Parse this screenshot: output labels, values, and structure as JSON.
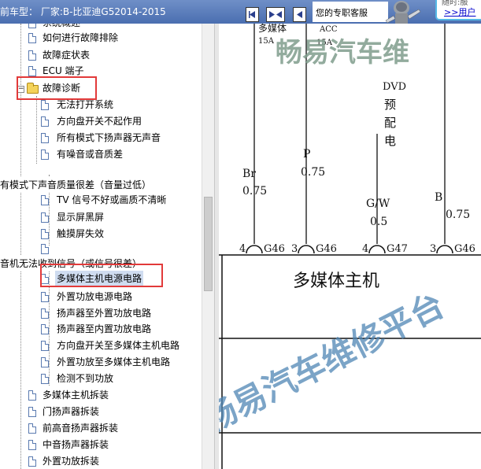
{
  "topbar": {
    "model_label": "前车型：  厂家:B-比亚迪G52014-2015",
    "nav_buttons": [
      "prev-arrow-icon",
      "double-arrow-icon",
      "next-arrow-icon"
    ],
    "support_text": "您的专职客服",
    "user_link_faint": "随时:服",
    "user_link": ">>用户"
  },
  "tree": {
    "items": [
      {
        "label": "系统概述"
      },
      {
        "label": "如何进行故障排除"
      },
      {
        "label": "故障症状表"
      },
      {
        "label": "ECU 端子"
      },
      {
        "label": "故障诊断",
        "folder": true,
        "expander": "⊟"
      },
      {
        "label": "无法打开系统"
      },
      {
        "label": "方向盘开关不起作用"
      },
      {
        "label": "所有模式下扬声器无声音"
      },
      {
        "label": "有噪音或音质差"
      },
      {
        "label": "有模式下声音质量很差（音量过低）"
      },
      {
        "label": "TV 信号不好或画质不清晰"
      },
      {
        "label": "显示屏黑屏"
      },
      {
        "label": "触摸屏失效"
      },
      {
        "label": ""
      },
      {
        "label": "音机无法收到信号（或信号很差）"
      },
      {
        "label": "多媒体主机电源电路",
        "selected": true
      },
      {
        "label": "外置功放电源电路"
      },
      {
        "label": "扬声器至外置功放电路"
      },
      {
        "label": "扬声器至内置功放电路"
      },
      {
        "label": "方向盘开关至多媒体主机电路"
      },
      {
        "label": "外置功放至多媒体主机电路"
      },
      {
        "label": "检测不到功放"
      },
      {
        "label": "多媒体主机拆装"
      },
      {
        "label": "门扬声器拆装"
      },
      {
        "label": "前高音扬声器拆装"
      },
      {
        "label": "中音扬声器拆装"
      },
      {
        "label": "外置功放拆装"
      }
    ]
  },
  "diagram": {
    "top_labels": [
      "多媒体",
      "15A",
      "ACC",
      "15A"
    ],
    "dvd_label": [
      "DVD",
      "预",
      "配",
      "电"
    ],
    "wires": [
      {
        "name": "Br",
        "size": "0.75",
        "pin": "4",
        "conn": "G46"
      },
      {
        "name": "P",
        "size": "0.75",
        "pin": "3",
        "conn": "G46"
      },
      {
        "name": "G/W",
        "size": "0.5",
        "pin": "4",
        "conn": "G47"
      },
      {
        "name": "B",
        "size": "0.75",
        "pin": "3",
        "conn": "G46"
      }
    ],
    "module_label": "多媒体主机",
    "watermark_top": "畅易汽车维",
    "watermark_diag": "畅易汽车维修平台"
  }
}
